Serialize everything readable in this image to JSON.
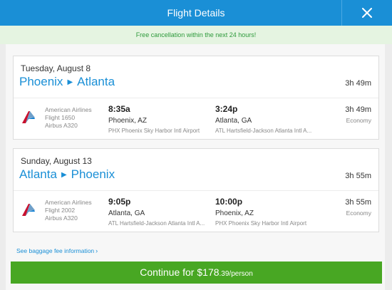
{
  "header": {
    "title": "Flight Details",
    "close_icon": "close-icon"
  },
  "notice": {
    "text": "Free cancellation within the next 24 hours!"
  },
  "trips": [
    {
      "date": "Tuesday, August 8",
      "origin": "Phoenix",
      "destination": "Atlanta",
      "duration": "3h 49m",
      "segment": {
        "airline": "American Airlines",
        "flight": "Flight 1650",
        "aircraft": "Airbus A320",
        "depart_time": "8:35a",
        "depart_city": "Phoenix, AZ",
        "depart_airport": "PHX Phoenix Sky Harbor Intl Airport",
        "arrive_time": "3:24p",
        "arrive_city": "Atlanta, GA",
        "arrive_airport": "ATL Hartsfield-Jackson Atlanta Intl A...",
        "duration": "3h 49m",
        "cabin": "Economy"
      }
    },
    {
      "date": "Sunday, August 13",
      "origin": "Atlanta",
      "destination": "Phoenix",
      "duration": "3h 55m",
      "segment": {
        "airline": "American Airlines",
        "flight": "Flight 2002",
        "aircraft": "Airbus A320",
        "depart_time": "9:05p",
        "depart_city": "Atlanta, GA",
        "depart_airport": "ATL Hartsfield-Jackson Atlanta Intl A...",
        "arrive_time": "10:00p",
        "arrive_city": "Phoenix, AZ",
        "arrive_airport": "PHX Phoenix Sky Harbor Intl Airport",
        "duration": "3h 55m",
        "cabin": "Economy"
      }
    }
  ],
  "baggage_link": "See baggage fee information",
  "continue": {
    "prefix": "Continue for ",
    "price_main": "$178",
    "price_rest": ".39/person"
  },
  "colors": {
    "primary": "#1a8fd6",
    "success": "#48a723",
    "notice_bg": "#e5f4e1",
    "notice_text": "#2e9a3c"
  }
}
